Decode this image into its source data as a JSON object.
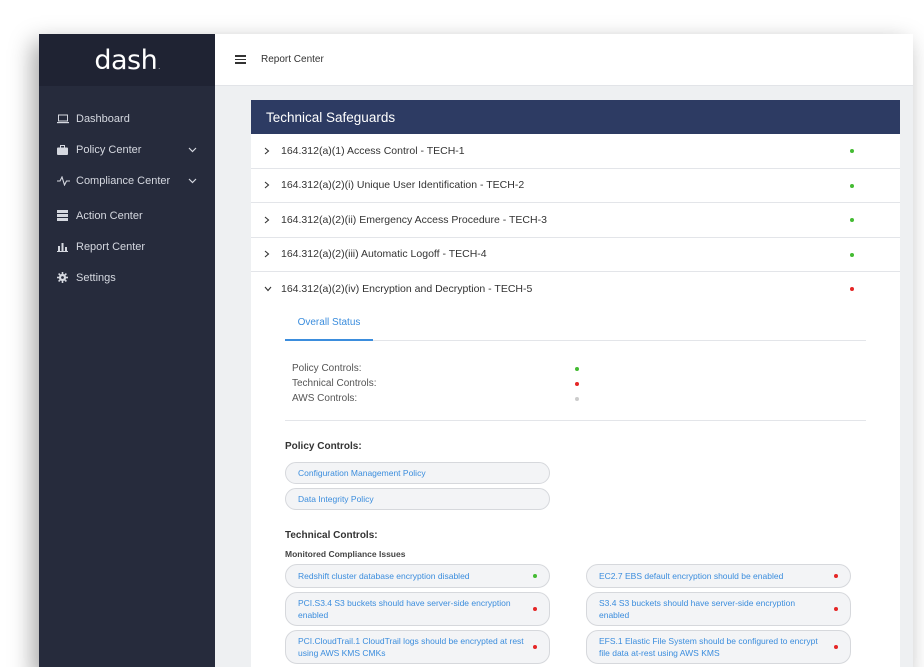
{
  "app": {
    "logo": "dash",
    "logo_mark": "."
  },
  "sidebar": {
    "items": [
      {
        "label": "Dashboard",
        "icon": "laptop-icon",
        "expandable": false
      },
      {
        "label": "Policy Center",
        "icon": "briefcase-icon",
        "expandable": true
      },
      {
        "label": "Compliance Center",
        "icon": "pulse-icon",
        "expandable": true
      },
      {
        "label": "Action Center",
        "icon": "server-icon",
        "expandable": false
      },
      {
        "label": "Report Center",
        "icon": "bar-chart-icon",
        "expandable": false
      },
      {
        "label": "Settings",
        "icon": "gear-icon",
        "expandable": false
      }
    ]
  },
  "topbar": {
    "title": "Report Center"
  },
  "colors": {
    "green": "#44bb33",
    "red": "#e52626",
    "gray": "#cccccc",
    "accent": "#3b8ddd",
    "header": "#2d3b63"
  },
  "panel": {
    "title": "Technical Safeguards",
    "rows": [
      {
        "label": "164.312(a)(1) Access Control - TECH-1",
        "status": "green",
        "expanded": false
      },
      {
        "label": "164.312(a)(2)(i) Unique User Identification - TECH-2",
        "status": "green",
        "expanded": false
      },
      {
        "label": "164.312(a)(2)(ii) Emergency Access Procedure - TECH-3",
        "status": "green",
        "expanded": false
      },
      {
        "label": "164.312(a)(2)(iii) Automatic Logoff - TECH-4",
        "status": "green",
        "expanded": false
      },
      {
        "label": "164.312(a)(2)(iv) Encryption and Decryption - TECH-5",
        "status": "red",
        "expanded": true
      }
    ]
  },
  "detail": {
    "tab": "Overall Status",
    "status": [
      {
        "label": "Policy Controls:",
        "status": "green"
      },
      {
        "label": "Technical Controls:",
        "status": "red"
      },
      {
        "label": "AWS Controls:",
        "status": "gray"
      }
    ],
    "policy_title": "Policy Controls:",
    "policies": [
      "Configuration Management Policy",
      "Data Integrity Policy"
    ],
    "technical_title": "Technical Controls:",
    "issues_subtitle": "Monitored Compliance Issues",
    "issues_left": [
      {
        "text": "Redshift cluster database encryption disabled",
        "status": "green"
      },
      {
        "text": "PCI.S3.4 S3 buckets should have server-side encryption enabled",
        "status": "red"
      },
      {
        "text": "PCI.CloudTrail.1 CloudTrail logs should be encrypted at rest using AWS KMS CMKs",
        "status": "red"
      }
    ],
    "issues_right": [
      {
        "text": "EC2.7 EBS default encryption should be enabled",
        "status": "red"
      },
      {
        "text": "S3.4 S3 buckets should have server-side encryption enabled",
        "status": "red"
      },
      {
        "text": "EFS.1 Elastic File System should be configured to encrypt file data at-rest using AWS KMS",
        "status": "red"
      }
    ]
  }
}
